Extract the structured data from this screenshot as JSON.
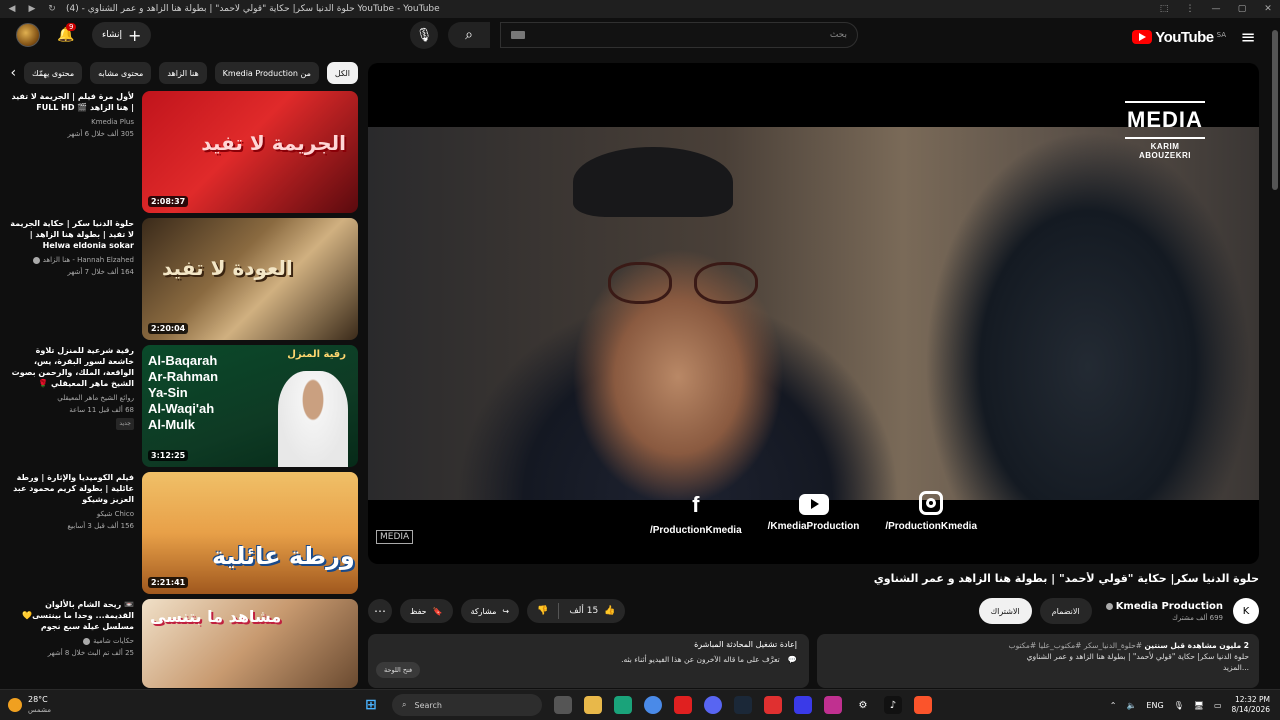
{
  "browser": {
    "tab_title": "حلوة الدنيا سكر| حكاية \"قولي لأحمد\" | بطولة هنا الزاهد و عمر الشناوي - (4) YouTube - YouTube"
  },
  "header": {
    "logo_text": "YouTube",
    "country_code": "SA",
    "search_placeholder": "بحث",
    "create_label": "إنشاء",
    "notifications_count": "9"
  },
  "player": {
    "watermark_logo": "MEDIA",
    "watermark_name": "KARIM ABOUZEKRI",
    "corner_logo": "MEDIA",
    "socials": [
      {
        "icon": "facebook-icon",
        "handle": "/ProductionKmedia"
      },
      {
        "icon": "youtube-icon",
        "handle": "/KmediaProduction"
      },
      {
        "icon": "instagram-icon",
        "handle": "/ProductionKmedia"
      }
    ]
  },
  "video": {
    "title": "حلوة الدنيا سكر| حكاية \"قولي لأحمد\" | بطولة هنا الزاهد و عمر الشناوي",
    "channel_name": "Kmedia Production",
    "subscribers": "699 ألف مشترك",
    "join_label": "الانضمام",
    "subscribed_label": "الاشتراك",
    "likes": "15 ألف",
    "share_label": "مشاركة",
    "save_label": "حفظ"
  },
  "description": {
    "views_line": "2 مليون مشاهدة  قبل سنتين",
    "tags": "#حلوة_الدنيا_سكر #مكتوب_عليا #مكتوب",
    "text": "حلوة الدنيا سكر| حكاية \"قولي لأحمد\" | بطولة هنا الزاهد و عمر الشناوي",
    "more": "...المزيد"
  },
  "chat_replay": {
    "title": "إعادة تشغيل المحادثة المباشرة",
    "subtitle": "تعرَّف على ما قاله الآخرون عن هذا الفيديو أثناء بثه.",
    "open_label": "فتح اللوحة"
  },
  "chips": [
    "الكل",
    "من Kmedia Production",
    "هنا الزاهد",
    "محتوى مشابه",
    "محتوى يهمّك"
  ],
  "recommendations": [
    {
      "title": "لأول مرة فيلم | الجريمة لا تفيد | هنا الزاهد 🎬 FULL HD",
      "channel": "Kmedia Plus",
      "stats": "305 ألف  خلال 6 أشهر",
      "duration": "2:08:37",
      "thumb_text": "الجريمة لا تفيد",
      "verified": false,
      "is_new": false
    },
    {
      "title": "حلوة الدنيا سكر | حكاية الجريمة لا تفيد | بطولة هنا الزاهد | Helwa eldonia sokar",
      "channel": "Hannah Elzahed - هنا الزاهد",
      "stats": "164 ألف  خلال 7 أشهر",
      "duration": "2:20:04",
      "thumb_text": "العودة لا تفيد",
      "verified": true,
      "is_new": false
    },
    {
      "title": "رقية شرعية للمنزل   تلاوة خاشعة لسور البقرة، يس، الواقعة، الملك، والرحمن بصوت الشيخ ماهر المعيقلي 🌹",
      "channel": "روائع الشيخ ماهر المعيقلي",
      "stats": "68 ألف  قبل 11 ساعة",
      "duration": "3:12:25",
      "thumb_text": "رقية المنزل",
      "quran_list": [
        "Al-Baqarah",
        "Ar-Rahman",
        "Ya-Sin",
        "Al-Waqi'ah",
        "Al-Mulk"
      ],
      "verified": false,
      "is_new": true,
      "new_label": "جديد"
    },
    {
      "title": "فيلم الكوميديا والإثارة | ورطة عائلية | بطولة كريم محمود عبد العزيز وشيكو",
      "channel": "Chico شيكو",
      "stats": "156 ألف  قبل 3 أسابيع",
      "duration": "2:21:41",
      "thumb_text": "ورطة عائلية",
      "verified": false,
      "is_new": false
    },
    {
      "title": "📼 ريحة الشام بالألوان القديمة... وحدا ما بينتسى💛 مسلسل عيلة سبع نجوم",
      "channel": "حكايات شامية",
      "stats": "25 ألف  تم البث خلال 8 أشهر",
      "duration": "",
      "thumb_text": "مشاهد ما بتنسى",
      "verified": true,
      "is_new": false
    }
  ],
  "taskbar": {
    "temperature": "28°C",
    "weather": "مشمس",
    "search_label": "Search",
    "language": "ENG",
    "time": "12:32 PM",
    "date": "8/14/2026"
  }
}
